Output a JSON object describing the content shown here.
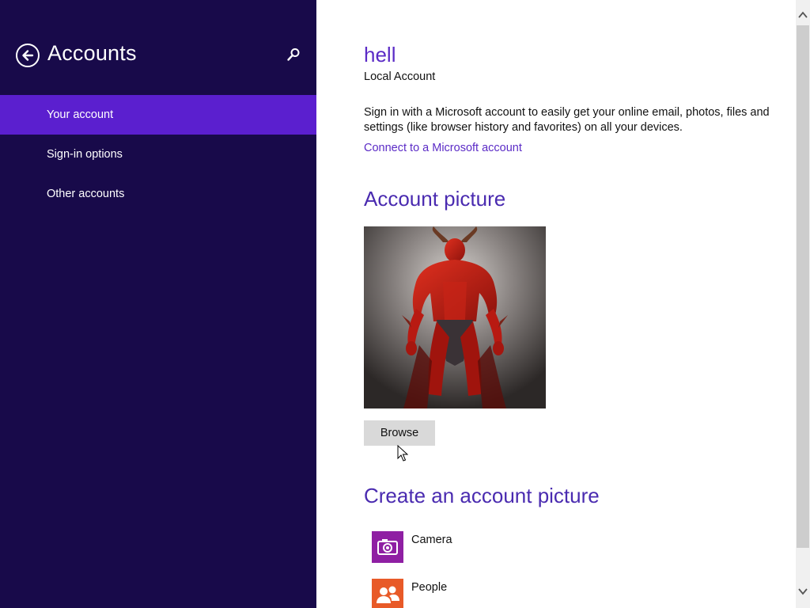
{
  "sidebar": {
    "title": "Accounts",
    "back_icon": "back-arrow-circle-icon",
    "search_icon": "search-icon",
    "items": [
      {
        "label": "Your account",
        "selected": true
      },
      {
        "label": "Sign-in options",
        "selected": false
      },
      {
        "label": "Other accounts",
        "selected": false
      }
    ]
  },
  "account": {
    "name": "hell",
    "type": "Local Account",
    "description": "Sign in with a Microsoft account to easily get your online email, photos, files and settings (like browser history and favorites) on all your devices.",
    "connect_link": "Connect to a Microsoft account"
  },
  "account_picture": {
    "title": "Account picture",
    "browse_label": "Browse"
  },
  "create_picture": {
    "title": "Create an account picture",
    "apps": [
      {
        "label": "Camera",
        "icon": "camera-icon",
        "color": "#8f1fa3"
      },
      {
        "label": "People",
        "icon": "people-icon",
        "color": "#e85a28"
      }
    ]
  },
  "colors": {
    "sidebar_bg": "#180a4a",
    "selected_bg": "#5b1fcf",
    "accent_text": "#5b2bc6"
  }
}
